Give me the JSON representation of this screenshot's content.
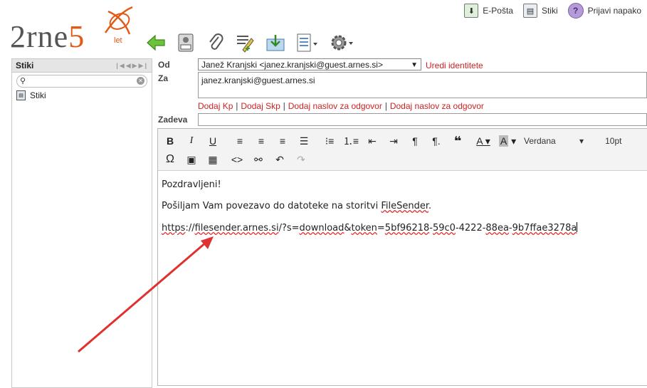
{
  "top_nav": {
    "email_label": "E-Pošta",
    "contacts_label": "Stiki",
    "report_label": "Prijavi napako"
  },
  "logo": {
    "brand_start": "2rne",
    "brand_num": "5",
    "suffix": "let"
  },
  "toolbar": {
    "icons": [
      "back-arrow-icon",
      "scanner-icon",
      "attachment-icon",
      "signature-icon",
      "save-icon",
      "document-options-icon",
      "settings-icon"
    ]
  },
  "left_panel": {
    "title": "Stiki",
    "search_placeholder": "",
    "items": [
      {
        "label": "Stiki"
      }
    ]
  },
  "form": {
    "from_label": "Od",
    "from_value": "Janež Kranjski <janez.kranjski@guest.arnes.si>",
    "edit_identity": "Uredi identitete",
    "to_label": "Za",
    "to_value": "janez.kranjski@guest.arnes.si",
    "add_links": [
      "Dodaj Kp",
      "Dodaj Skp",
      "Dodaj naslov za odgovor",
      "Dodaj naslov za odgovor"
    ],
    "subject_label": "Zadeva",
    "subject_value": ""
  },
  "editor": {
    "font_name": "Verdana",
    "font_size": "10pt",
    "greeting": "Pozdravljeni!",
    "line2_prefix": "Pošiljam Vam povezavo do datoteke na storitvi ",
    "line2_link": "FileSender",
    "line2_suffix": ".",
    "url_parts": [
      "https",
      "://",
      "filesender.arnes.si",
      "/?s=",
      "download",
      "&",
      "token",
      "=",
      "5bf96218",
      "-",
      "59c0",
      "-4222-",
      "88ea",
      "-",
      "9b7ffae3278a"
    ]
  },
  "colors": {
    "brand_orange": "#e15a16",
    "link_red": "#cc2222",
    "annotation_arrow": "#e03030"
  }
}
